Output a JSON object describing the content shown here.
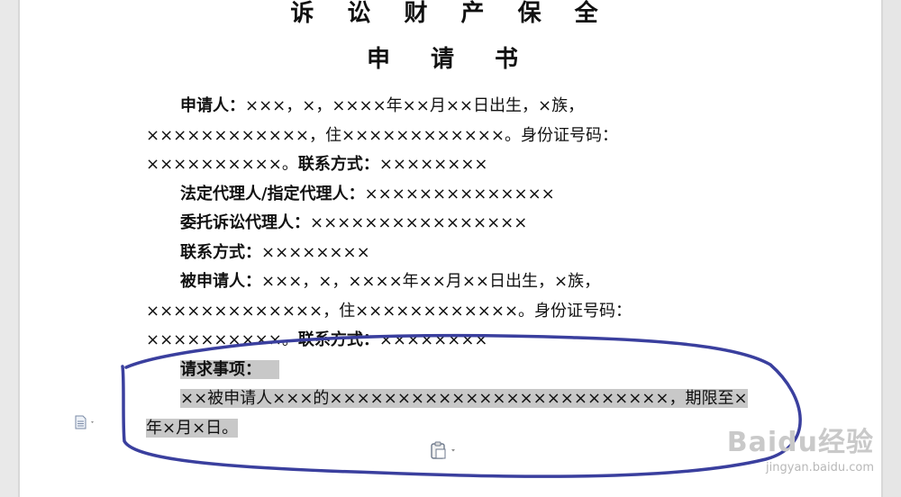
{
  "document": {
    "title_line1": "诉 讼 财 产 保 全",
    "title_line2": "申 请 书",
    "applicant": {
      "label": "申请人：",
      "text": "×××，×，××××年××月××日出生，×族，××××××××××××，住××××××××××××。身份证号码：××××××××××。"
    },
    "applicant_contact": {
      "label": "联系方式：",
      "text": "××××××××"
    },
    "legal_rep": {
      "label": "法定代理人/指定代理人：",
      "text": "××××××××××××××"
    },
    "agent": {
      "label": "委托诉讼代理人：",
      "text": "××××××××××××××××"
    },
    "agent_contact": {
      "label": "联系方式：",
      "text": "××××××××"
    },
    "respondent": {
      "label": "被申请人：",
      "text": "×××，×，××××年××月××日出生，×族，×××××××××××××，住××××××××××××。身份证号码：××××××××××。"
    },
    "respondent_contact": {
      "label": "联系方式：",
      "text": "××××××××"
    },
    "request": {
      "label": "请求事项：",
      "text": "××被申请人×××的×××××××××××××××××××××××××，期限至×年×月×日。"
    }
  },
  "icons": {
    "doc": "document-icon",
    "paste": "paste-options-icon"
  },
  "annotation": {
    "color": "#3a3f9e"
  },
  "watermark": {
    "brand": "Baidu经验",
    "url": "jingyan.baidu.com"
  }
}
